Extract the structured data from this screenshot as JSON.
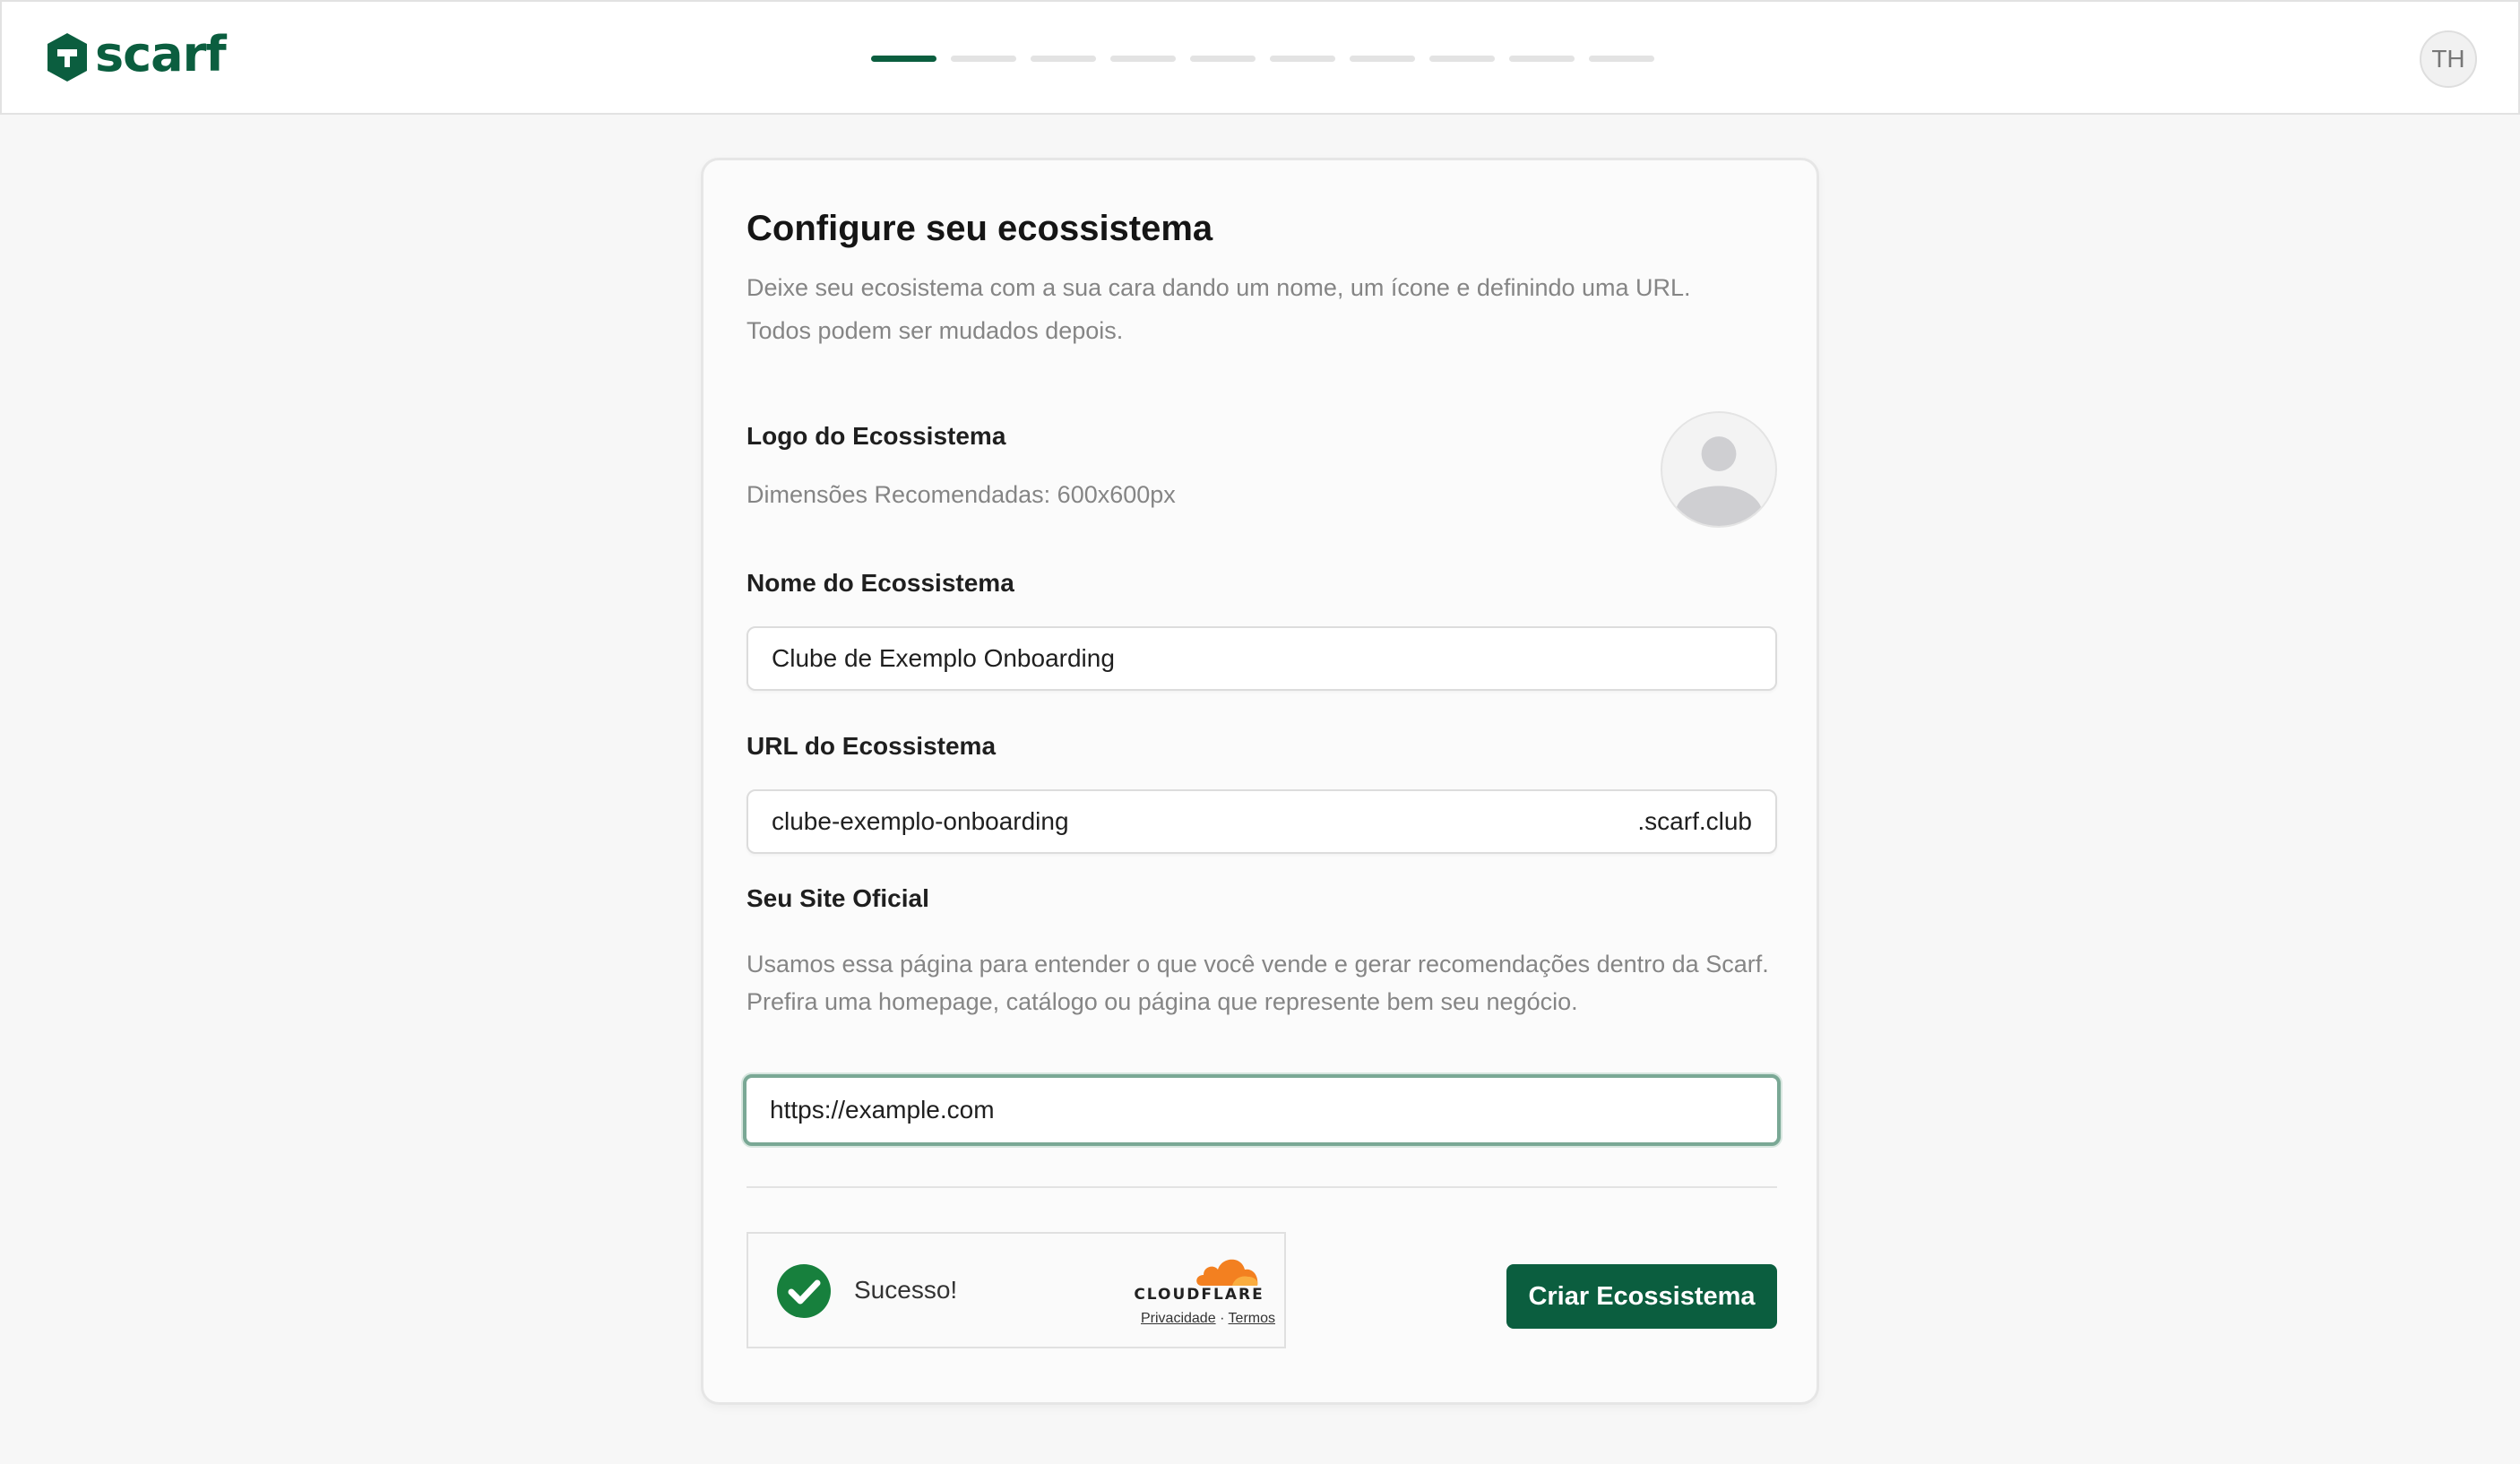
{
  "brand": {
    "name": "scarf",
    "color": "#0b5e3f"
  },
  "header": {
    "steps_total": 10,
    "current_step": 1,
    "user_initials": "TH"
  },
  "form": {
    "title": "Configure seu ecossistema",
    "subtitle_line1": "Deixe seu ecosistema com a sua cara dando um nome, um ícone e definindo uma URL.",
    "subtitle_line2": "Todos podem ser mudados depois.",
    "logo": {
      "label": "Logo do Ecossistema",
      "hint": "Dimensões Recomendadas: 600x600px",
      "icon": "user-placeholder-icon"
    },
    "name": {
      "label": "Nome do Ecossistema",
      "value": "Clube de Exemplo Onboarding"
    },
    "url": {
      "label": "URL do Ecossistema",
      "value": "clube-exemplo-onboarding",
      "suffix": ".scarf.club"
    },
    "site": {
      "label": "Seu Site Oficial",
      "hint_line1": "Usamos essa página para entender o que você vende e gerar recomendações dentro da Scarf.",
      "hint_line2": "Prefira uma homepage, catálogo ou página que represente bem seu negócio.",
      "value": "https://example.com"
    },
    "captcha": {
      "status": "Sucesso!",
      "provider": "CLOUDFLARE",
      "privacy_label": "Privacidade",
      "separator": "·",
      "terms_label": "Termos",
      "success_color": "#17803d",
      "cloud_color": "#f38020"
    },
    "submit_label": "Criar Ecossistema"
  }
}
